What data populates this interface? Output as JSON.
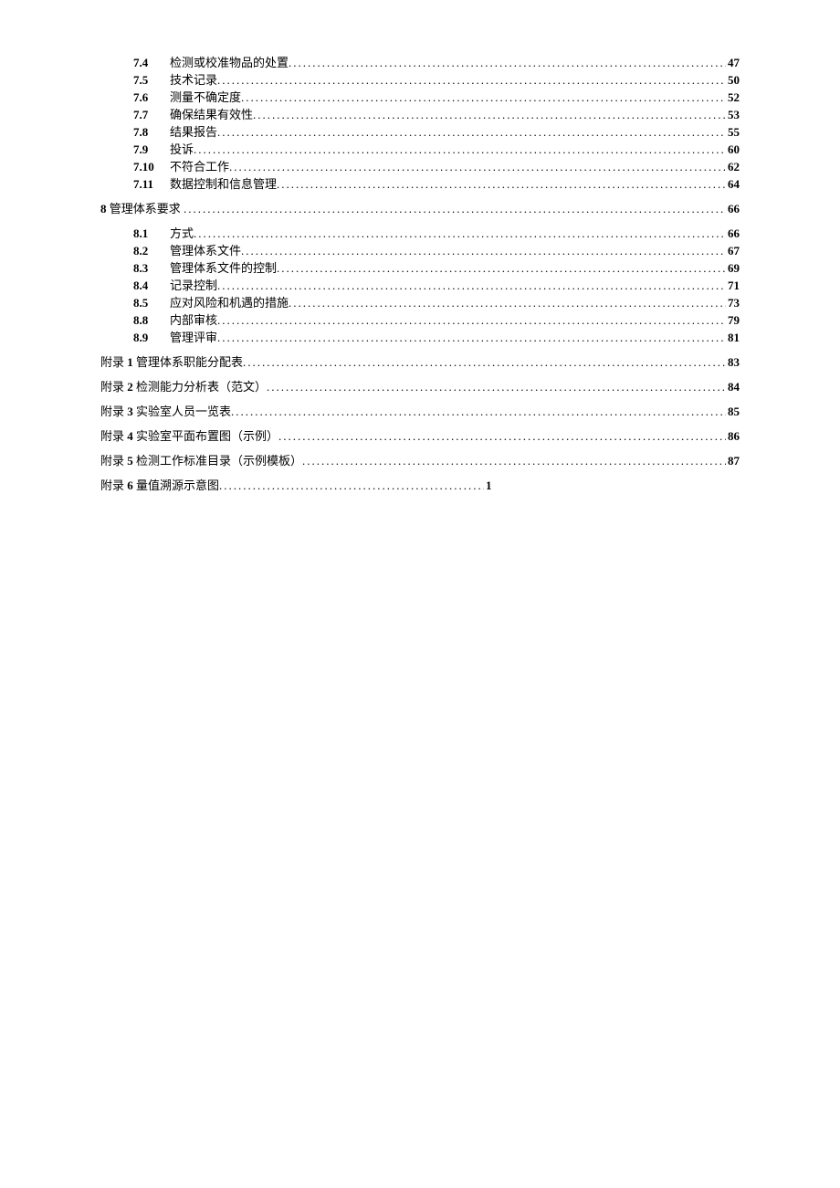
{
  "section7": [
    {
      "num": "7.4",
      "title": "检测或校准物品的处置",
      "page": "47"
    },
    {
      "num": "7.5",
      "title": "技术记录",
      "page": "50"
    },
    {
      "num": "7.6",
      "title": "测量不确定度",
      "page": "52"
    },
    {
      "num": "7.7",
      "title": "确保结果有效性",
      "page": "53"
    },
    {
      "num": "7.8",
      "title": "结果报告",
      "page": "55"
    },
    {
      "num": "7.9",
      "title": "投诉",
      "page": "60"
    },
    {
      "num": "7.10",
      "title": "不符合工作",
      "page": "62",
      "pad": true
    },
    {
      "num": "7.11",
      "title": "数据控制和信息管理",
      "page": "64",
      "pad": true
    }
  ],
  "section8_head": {
    "num": "8",
    "title": "管理体系要求",
    "page": "66"
  },
  "section8": [
    {
      "num": "8.1",
      "title": "方式",
      "page": "66"
    },
    {
      "num": "8.2",
      "title": "管理体系文件",
      "page": "67"
    },
    {
      "num": "8.3",
      "title": "管理体系文件的控制",
      "page": "69"
    },
    {
      "num": "8.4",
      "title": "记录控制",
      "page": "71"
    },
    {
      "num": "8.5",
      "title": "应对风险和机遇的措施",
      "page": "73"
    },
    {
      "num": "8.8",
      "title": "内部审核",
      "page": "79",
      "pad": true
    },
    {
      "num": "8.9",
      "title": "管理评审",
      "page": "81"
    }
  ],
  "appendices": [
    {
      "prefix": "附录 ",
      "num": "1",
      "title": " 管理体系职能分配表",
      "page": "83"
    },
    {
      "prefix": "附录 ",
      "num": "2",
      "title": " 检测能力分析表（范文）",
      "page": "84"
    },
    {
      "prefix": "附录 ",
      "num": "3",
      "title": " 实验室人员一览表",
      "page": "85"
    },
    {
      "prefix": "附录 ",
      "num": "4",
      "title": " 实验室平面布置图（示例）",
      "page": "86"
    },
    {
      "prefix": "附录 ",
      "num": "5",
      "title": " 检测工作标准目录（示例模板）",
      "page": "87"
    },
    {
      "prefix": "附录 ",
      "num": "6",
      "title": " 量值溯源示意图",
      "page": "1",
      "short": true
    }
  ]
}
